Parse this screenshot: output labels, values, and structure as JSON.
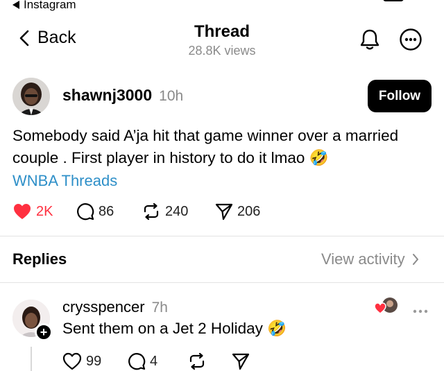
{
  "status_bar": {
    "back_app": "Instagram"
  },
  "header": {
    "back_label": "Back",
    "title": "Thread",
    "views": "28.8K views"
  },
  "post": {
    "username": "shawnj3000",
    "time": "10h",
    "follow_label": "Follow",
    "text_line1": "Somebody said A’ja hit that game winner over a married",
    "text_line2": "couple . First player in history to do it lmao",
    "emoji": "🤣",
    "tag": "WNBA Threads",
    "likes": "2K",
    "comments": "86",
    "reposts": "240",
    "shares": "206"
  },
  "replies_section": {
    "label": "Replies",
    "view_activity": "View activity"
  },
  "reply": {
    "username": "crysspencer",
    "time": "7h",
    "text": "Sent them on a Jet 2 Holiday",
    "emoji": "🤣",
    "likes": "99",
    "comments": "4",
    "plus": "+"
  },
  "colors": {
    "like_red": "#ff3040",
    "tag_blue": "#2e8fc8",
    "muted": "#8a8a8a"
  },
  "icons": [
    "back-chevron-icon",
    "bell-icon",
    "more-icon",
    "heart-icon",
    "comment-icon",
    "repost-icon",
    "share-icon",
    "chevron-right-icon"
  ]
}
